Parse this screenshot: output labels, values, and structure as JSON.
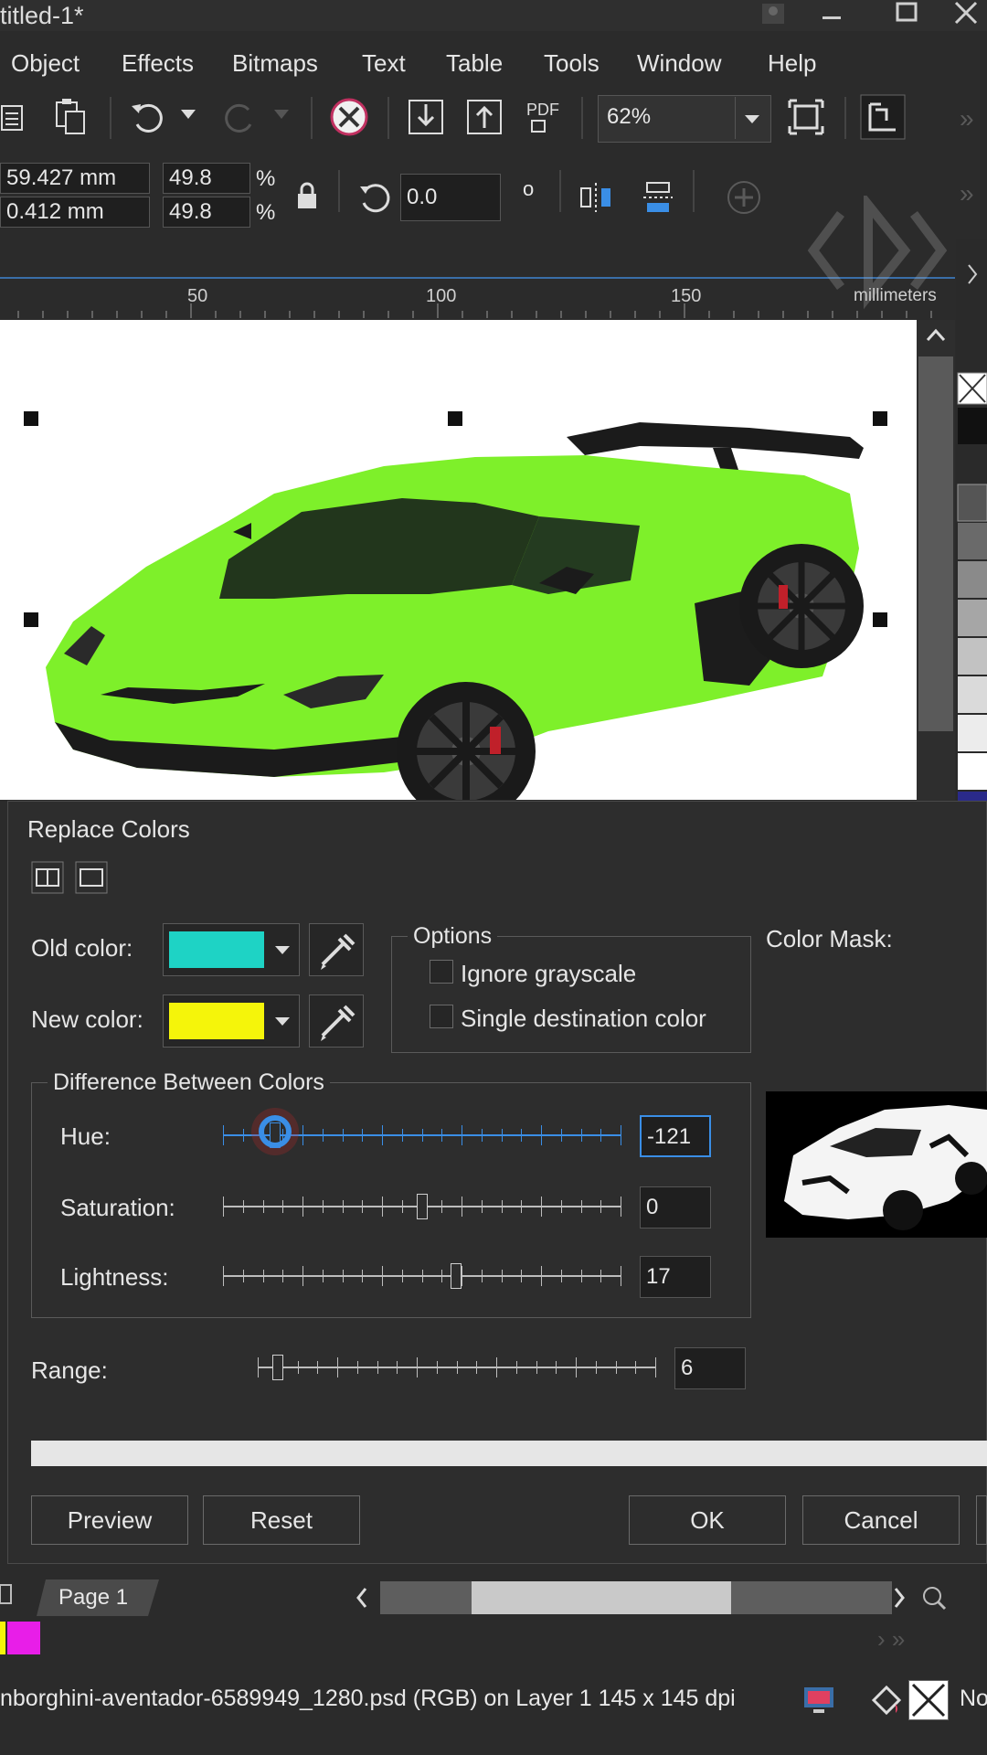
{
  "window": {
    "title": "titled-1*"
  },
  "menu": [
    {
      "label": "Object"
    },
    {
      "label": "Effects"
    },
    {
      "label": "Bitmaps"
    },
    {
      "label": "Text"
    },
    {
      "label": "Table"
    },
    {
      "label": "Tools"
    },
    {
      "label": "Window"
    },
    {
      "label": "Help"
    }
  ],
  "toolbar": {
    "pdf_label": "PDF",
    "zoom": "62%"
  },
  "properties": {
    "x": "59.427 mm",
    "y": "0.412 mm",
    "scale_x": "49.8",
    "scale_y": "49.8",
    "pct1": "%",
    "pct2": "%",
    "rotation": "0.0",
    "degree": "o"
  },
  "ruler": {
    "ticks": [
      "50",
      "100",
      "150"
    ],
    "units": "millimeters"
  },
  "dialog": {
    "title": "Replace Colors",
    "old_color_label": "Old color:",
    "new_color_label": "New color:",
    "old_color": "#1ed3c5",
    "new_color": "#f5f50a",
    "options": {
      "title": "Options",
      "ignore_grayscale": "Ignore grayscale",
      "single_destination": "Single destination color"
    },
    "color_mask_label": "Color Mask:",
    "difference": {
      "title": "Difference Between Colors",
      "hue": {
        "label": "Hue:",
        "value": "-121",
        "position": 0.13
      },
      "saturation": {
        "label": "Saturation:",
        "value": "0",
        "position": 0.5
      },
      "lightness": {
        "label": "Lightness:",
        "value": "17",
        "position": 0.585
      }
    },
    "range": {
      "label": "Range:",
      "value": "6",
      "position": 0.05
    },
    "buttons": {
      "preview": "Preview",
      "reset": "Reset",
      "ok": "OK",
      "cancel": "Cancel"
    }
  },
  "page_tab": "Page 1",
  "status": {
    "file": "nborghini-aventador-6589949_1280.psd (RGB) on Layer 1 145 x 145 dpi",
    "fill": "No"
  },
  "colors": {
    "accent": "#3a8ee6",
    "car_green": "#7ef02a",
    "magenta": "#e81ee8"
  }
}
